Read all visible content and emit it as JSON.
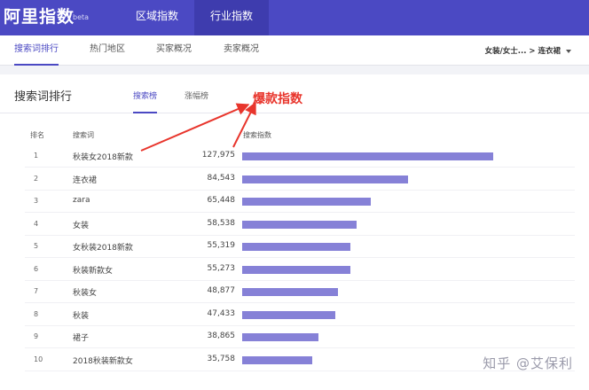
{
  "header": {
    "logo": "阿里指数",
    "beta": "beta",
    "nav": [
      "区域指数",
      "行业指数"
    ]
  },
  "subnav": {
    "tabs": [
      "搜索词排行",
      "热门地区",
      "买家概况",
      "卖家概况"
    ],
    "breadcrumb": "女装/女士... > 连衣裙"
  },
  "panel": {
    "title": "搜索词排行",
    "tabs": [
      "搜索榜",
      "涨幅榜"
    ],
    "annotation": "爆款指数",
    "columns": {
      "rank": "排名",
      "keyword": "搜索词",
      "index": "搜索指数"
    },
    "rows": [
      {
        "rank": "1",
        "keyword": "秋装女2018新款",
        "value": 127975,
        "display": "127,975"
      },
      {
        "rank": "2",
        "keyword": "连衣裙",
        "value": 84543,
        "display": "84,543"
      },
      {
        "rank": "3",
        "keyword": "zara",
        "value": 65448,
        "display": "65,448"
      },
      {
        "rank": "4",
        "keyword": "女装",
        "value": 58538,
        "display": "58,538"
      },
      {
        "rank": "5",
        "keyword": "女秋装2018新款",
        "value": 55319,
        "display": "55,319"
      },
      {
        "rank": "6",
        "keyword": "秋装新款女",
        "value": 55273,
        "display": "55,273"
      },
      {
        "rank": "7",
        "keyword": "秋装女",
        "value": 48877,
        "display": "48,877"
      },
      {
        "rank": "8",
        "keyword": "秋装",
        "value": 47433,
        "display": "47,433"
      },
      {
        "rank": "9",
        "keyword": "裙子",
        "value": 38865,
        "display": "38,865"
      },
      {
        "rank": "10",
        "keyword": "2018秋装新款女",
        "value": 35758,
        "display": "35,758"
      }
    ]
  },
  "watermark": "知乎 @艾保利",
  "colors": {
    "brand": "#4b49c3",
    "bar": "#8681d7",
    "annotation": "#e8352c"
  }
}
